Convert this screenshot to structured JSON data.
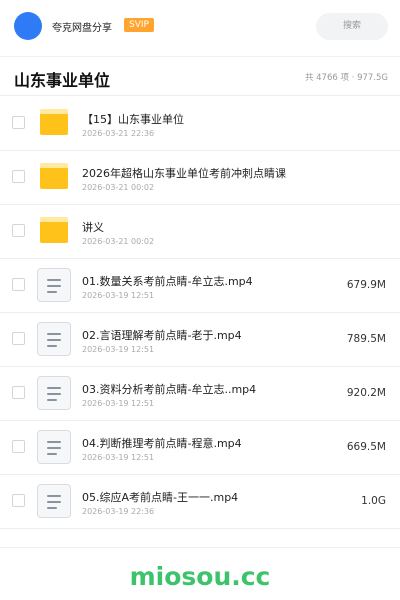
{
  "header": {
    "username": "夸克网盘分享",
    "badge": "SVIP",
    "search_placeholder": "搜索"
  },
  "folder": {
    "title": "山东事业单位",
    "summary": "共 4766 项 · 977.5G"
  },
  "files": [
    {
      "type": "folder",
      "name": "【15】山东事业单位",
      "date": "2026-03-21 22:36",
      "size": ""
    },
    {
      "type": "folder",
      "name": "2026年超格山东事业单位考前冲刺点睛课",
      "date": "2026-03-21 00:02",
      "size": ""
    },
    {
      "type": "folder",
      "name": "讲义",
      "date": "2026-03-21 00:02",
      "size": ""
    },
    {
      "type": "file",
      "name": "01.数量关系考前点睛-牟立志.mp4",
      "date": "2026-03-19 12:51",
      "size": "679.9M"
    },
    {
      "type": "file",
      "name": "02.言语理解考前点睛-老于.mp4",
      "date": "2026-03-19 12:51",
      "size": "789.5M"
    },
    {
      "type": "file",
      "name": "03.资料分析考前点睛-牟立志..mp4",
      "date": "2026-03-19 12:51",
      "size": "920.2M"
    },
    {
      "type": "file",
      "name": "04.判断推理考前点睛-程意.mp4",
      "date": "2026-03-19 12:51",
      "size": "669.5M"
    },
    {
      "type": "file",
      "name": "05.综应A考前点睛-王一一.mp4",
      "date": "2026-03-19 22:36",
      "size": "1.0G"
    }
  ],
  "watermark": "miosou.cc"
}
